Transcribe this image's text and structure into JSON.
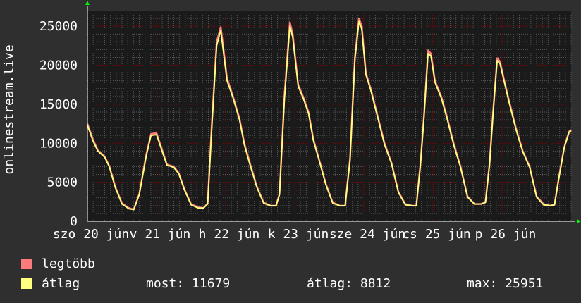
{
  "chart_data": {
    "type": "line",
    "ylabel": "onlinestream.live",
    "ylim": [
      0,
      27000
    ],
    "yticks": [
      0,
      5000,
      10000,
      15000,
      20000,
      25000
    ],
    "xticks": [
      {
        "label": "szo 20 jún",
        "day": 0
      },
      {
        "label": "v 21 jún",
        "day": 1
      },
      {
        "label": "h 22 jún",
        "day": 2
      },
      {
        "label": "k 23 jún",
        "day": 3
      },
      {
        "label": "sze 24 jún",
        "day": 4
      },
      {
        "label": "cs 25 jún",
        "day": 5
      },
      {
        "label": "p 26 jún",
        "day": 6
      }
    ],
    "xlim": [
      0,
      7
    ],
    "grid": true,
    "series": [
      {
        "name": "legtöbb",
        "color": "#ff7b7b",
        "points": [
          [
            0,
            12500
          ],
          [
            0.08,
            10500
          ],
          [
            0.15,
            9100
          ],
          [
            0.25,
            8300
          ],
          [
            0.32,
            7000
          ],
          [
            0.4,
            4500
          ],
          [
            0.5,
            2300
          ],
          [
            0.6,
            1700
          ],
          [
            0.67,
            1500
          ],
          [
            0.75,
            3500
          ],
          [
            0.85,
            8500
          ],
          [
            0.92,
            11200
          ],
          [
            1.0,
            11300
          ],
          [
            1.08,
            9200
          ],
          [
            1.15,
            7300
          ],
          [
            1.25,
            7000
          ],
          [
            1.32,
            6200
          ],
          [
            1.4,
            4200
          ],
          [
            1.5,
            2200
          ],
          [
            1.6,
            1800
          ],
          [
            1.68,
            1700
          ],
          [
            1.74,
            2300
          ],
          [
            1.8,
            12500
          ],
          [
            1.87,
            23000
          ],
          [
            1.93,
            24900
          ],
          [
            1.97,
            22000
          ],
          [
            2.02,
            18300
          ],
          [
            2.1,
            16200
          ],
          [
            2.2,
            13200
          ],
          [
            2.27,
            10000
          ],
          [
            2.35,
            7500
          ],
          [
            2.45,
            4500
          ],
          [
            2.55,
            2400
          ],
          [
            2.65,
            2000
          ],
          [
            2.73,
            2000
          ],
          [
            2.78,
            3500
          ],
          [
            2.85,
            16000
          ],
          [
            2.93,
            25500
          ],
          [
            2.97,
            24000
          ],
          [
            3.05,
            17500
          ],
          [
            3.12,
            16000
          ],
          [
            3.2,
            14000
          ],
          [
            3.27,
            10500
          ],
          [
            3.35,
            8000
          ],
          [
            3.45,
            4800
          ],
          [
            3.55,
            2400
          ],
          [
            3.65,
            2000
          ],
          [
            3.73,
            2000
          ],
          [
            3.8,
            8000
          ],
          [
            3.87,
            21000
          ],
          [
            3.93,
            26000
          ],
          [
            3.97,
            25000
          ],
          [
            4.03,
            19000
          ],
          [
            4.1,
            17000
          ],
          [
            4.2,
            13500
          ],
          [
            4.3,
            10000
          ],
          [
            4.4,
            7500
          ],
          [
            4.5,
            3800
          ],
          [
            4.6,
            2200
          ],
          [
            4.7,
            2000
          ],
          [
            4.76,
            2000
          ],
          [
            4.82,
            7500
          ],
          [
            4.87,
            13500
          ],
          [
            4.93,
            21900
          ],
          [
            4.97,
            21500
          ],
          [
            5.03,
            18000
          ],
          [
            5.12,
            16000
          ],
          [
            5.2,
            13500
          ],
          [
            5.3,
            10000
          ],
          [
            5.4,
            7000
          ],
          [
            5.5,
            3200
          ],
          [
            5.6,
            2200
          ],
          [
            5.7,
            2200
          ],
          [
            5.76,
            2500
          ],
          [
            5.82,
            7500
          ],
          [
            5.87,
            14000
          ],
          [
            5.93,
            20900
          ],
          [
            5.97,
            20500
          ],
          [
            6.02,
            18500
          ],
          [
            6.1,
            15500
          ],
          [
            6.2,
            12000
          ],
          [
            6.3,
            9000
          ],
          [
            6.4,
            7000
          ],
          [
            6.5,
            3200
          ],
          [
            6.6,
            2200
          ],
          [
            6.7,
            2000
          ],
          [
            6.76,
            2200
          ],
          [
            6.82,
            5500
          ],
          [
            6.9,
            9500
          ],
          [
            6.97,
            11500
          ],
          [
            7.0,
            11700
          ]
        ]
      },
      {
        "name": "átlag",
        "color": "#ffff80",
        "points": [
          [
            0,
            12300
          ],
          [
            0.08,
            10300
          ],
          [
            0.15,
            9000
          ],
          [
            0.25,
            8200
          ],
          [
            0.32,
            6900
          ],
          [
            0.4,
            4400
          ],
          [
            0.5,
            2200
          ],
          [
            0.6,
            1600
          ],
          [
            0.67,
            1500
          ],
          [
            0.75,
            3400
          ],
          [
            0.85,
            8300
          ],
          [
            0.92,
            11000
          ],
          [
            1.0,
            11100
          ],
          [
            1.08,
            9000
          ],
          [
            1.15,
            7200
          ],
          [
            1.25,
            6900
          ],
          [
            1.32,
            6100
          ],
          [
            1.4,
            4100
          ],
          [
            1.5,
            2100
          ],
          [
            1.6,
            1700
          ],
          [
            1.68,
            1700
          ],
          [
            1.74,
            2200
          ],
          [
            1.8,
            12000
          ],
          [
            1.87,
            22500
          ],
          [
            1.93,
            24500
          ],
          [
            1.97,
            21500
          ],
          [
            2.02,
            18000
          ],
          [
            2.1,
            16000
          ],
          [
            2.2,
            13000
          ],
          [
            2.27,
            9800
          ],
          [
            2.35,
            7300
          ],
          [
            2.45,
            4400
          ],
          [
            2.55,
            2300
          ],
          [
            2.65,
            2000
          ],
          [
            2.73,
            2000
          ],
          [
            2.78,
            3400
          ],
          [
            2.85,
            15500
          ],
          [
            2.93,
            25000
          ],
          [
            2.97,
            23600
          ],
          [
            3.05,
            17300
          ],
          [
            3.12,
            15800
          ],
          [
            3.2,
            13800
          ],
          [
            3.27,
            10300
          ],
          [
            3.35,
            7900
          ],
          [
            3.45,
            4700
          ],
          [
            3.55,
            2300
          ],
          [
            3.65,
            2000
          ],
          [
            3.73,
            2000
          ],
          [
            3.8,
            7800
          ],
          [
            3.87,
            20600
          ],
          [
            3.93,
            25600
          ],
          [
            3.97,
            24600
          ],
          [
            4.03,
            18800
          ],
          [
            4.1,
            16800
          ],
          [
            4.2,
            13300
          ],
          [
            4.3,
            9800
          ],
          [
            4.4,
            7400
          ],
          [
            4.5,
            3700
          ],
          [
            4.6,
            2100
          ],
          [
            4.7,
            2000
          ],
          [
            4.76,
            2000
          ],
          [
            4.82,
            7300
          ],
          [
            4.87,
            13300
          ],
          [
            4.93,
            21500
          ],
          [
            4.97,
            21200
          ],
          [
            5.03,
            17800
          ],
          [
            5.12,
            15800
          ],
          [
            5.2,
            13300
          ],
          [
            5.3,
            9800
          ],
          [
            5.4,
            6900
          ],
          [
            5.5,
            3100
          ],
          [
            5.6,
            2200
          ],
          [
            5.7,
            2200
          ],
          [
            5.76,
            2400
          ],
          [
            5.82,
            7300
          ],
          [
            5.87,
            13800
          ],
          [
            5.93,
            20600
          ],
          [
            5.97,
            20200
          ],
          [
            6.02,
            18300
          ],
          [
            6.1,
            15300
          ],
          [
            6.2,
            11800
          ],
          [
            6.3,
            8900
          ],
          [
            6.4,
            6900
          ],
          [
            6.5,
            3100
          ],
          [
            6.6,
            2100
          ],
          [
            6.7,
            2000
          ],
          [
            6.76,
            2100
          ],
          [
            6.82,
            5400
          ],
          [
            6.9,
            9400
          ],
          [
            6.97,
            11400
          ],
          [
            7.0,
            11600
          ]
        ]
      }
    ]
  },
  "legend": {
    "items": [
      {
        "label": "legtöbb",
        "color": "#ff7b7b"
      },
      {
        "label": "átlag",
        "color": "#ffff80"
      }
    ]
  },
  "stats": {
    "now": "most: 11679",
    "avg": "átlag: 8812",
    "max": "max: 25951"
  },
  "colors": {
    "background": "#2f2f2f",
    "plot_background": "#1a1a1a",
    "grid_major": "#8b0000",
    "grid_minor": "#555555",
    "axis": "#ffffff",
    "arrow": "#00ff00"
  }
}
